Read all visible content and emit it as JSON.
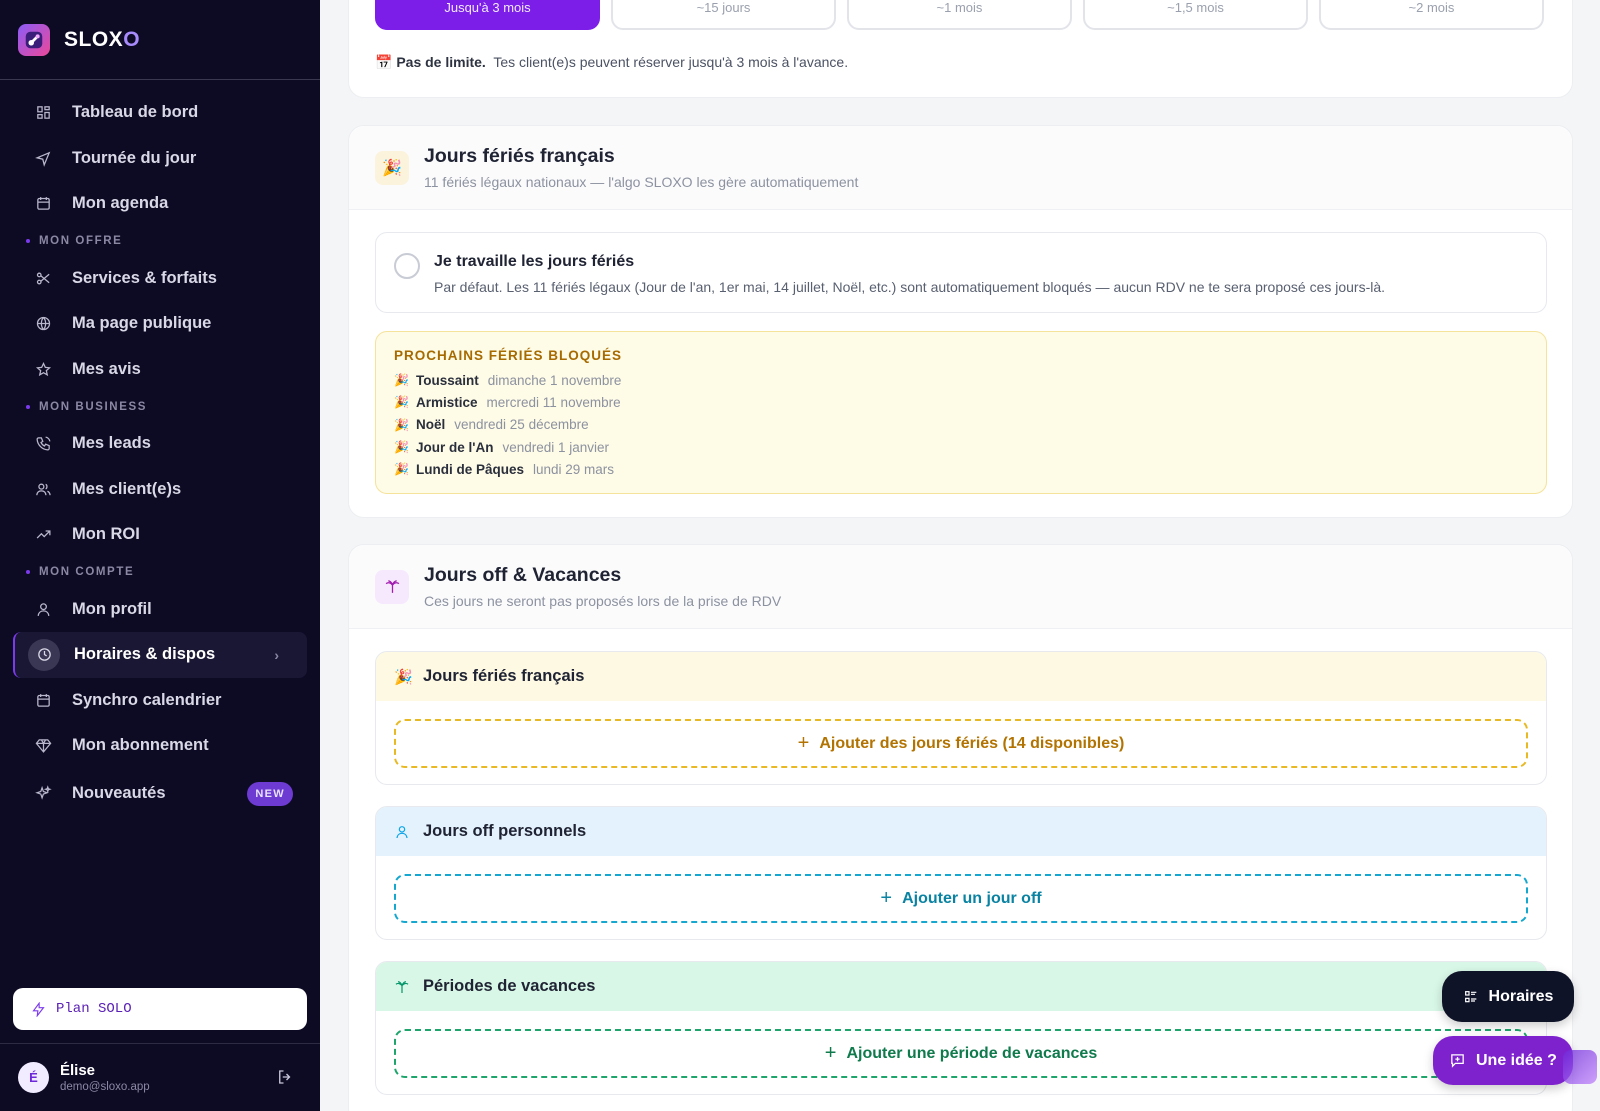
{
  "brand": {
    "name_main": "SLOX",
    "name_accent": "O"
  },
  "sidebar": {
    "top_items": [
      {
        "label": "Tableau de bord",
        "icon": "dashboard-icon"
      },
      {
        "label": "Tournée du jour",
        "icon": "navigation-icon"
      },
      {
        "label": "Mon agenda",
        "icon": "calendar-icon"
      }
    ],
    "sections": [
      {
        "title": "MON OFFRE",
        "items": [
          {
            "label": "Services & forfaits",
            "icon": "scissors-icon"
          },
          {
            "label": "Ma page publique",
            "icon": "globe-icon"
          },
          {
            "label": "Mes avis",
            "icon": "star-icon"
          }
        ]
      },
      {
        "title": "MON BUSINESS",
        "items": [
          {
            "label": "Mes leads",
            "icon": "phone-icon"
          },
          {
            "label": "Mes client(e)s",
            "icon": "users-icon"
          },
          {
            "label": "Mon ROI",
            "icon": "trending-up-icon"
          }
        ]
      },
      {
        "title": "MON COMPTE",
        "items": [
          {
            "label": "Mon profil",
            "icon": "user-icon"
          },
          {
            "label": "Horaires & dispos",
            "icon": "clock-icon",
            "active": true
          },
          {
            "label": "Synchro calendrier",
            "icon": "calendar-sync-icon"
          },
          {
            "label": "Mon abonnement",
            "icon": "diamond-icon"
          },
          {
            "label": "Nouveautés",
            "icon": "sparkles-icon",
            "badge": "NEW"
          }
        ]
      }
    ],
    "plan_label": "Plan SOLO",
    "user": {
      "initial": "É",
      "name": "Élise",
      "email": "demo@sloxo.app"
    }
  },
  "booking_range": {
    "options": [
      "Jusqu'à 3 mois",
      "~15 jours",
      "~1 mois",
      "~1,5 mois",
      "~2 mois"
    ],
    "selected": "Jusqu'à 3 mois",
    "note_icon": "📅",
    "note_bold": "Pas de limite.",
    "note_text": "Tes client(e)s peuvent réserver jusqu'à 3 mois à l'avance."
  },
  "holidays_card": {
    "icon": "🎉",
    "title": "Jours fériés français",
    "subtitle": "11 fériés légaux nationaux — l'algo SLOXO les gère automatiquement",
    "toggle_title": "Je travaille les jours fériés",
    "toggle_desc": "Par défaut. Les 11 fériés légaux (Jour de l'an, 1er mai, 14 juillet, Noël, etc.) sont automatiquement bloqués — aucun RDV ne te sera proposé ces jours-là.",
    "toggle_checked": false,
    "upcoming_title": "PROCHAINS FÉRIÉS BLOQUÉS",
    "upcoming": [
      {
        "name": "Toussaint",
        "date": "dimanche 1 novembre"
      },
      {
        "name": "Armistice",
        "date": "mercredi 11 novembre"
      },
      {
        "name": "Noël",
        "date": "vendredi 25 décembre"
      },
      {
        "name": "Jour de l'An",
        "date": "vendredi 1 janvier"
      },
      {
        "name": "Lundi de Pâques",
        "date": "lundi 29 mars"
      }
    ]
  },
  "off_card": {
    "icon": "palm-tree-icon",
    "title": "Jours off & Vacances",
    "subtitle": "Ces jours ne seront pas proposés lors de la prise de RDV",
    "blocks": [
      {
        "title": "Jours fériés français",
        "icon": "🎉",
        "button": "Ajouter des jours fériés (14 disponibles)"
      },
      {
        "title": "Jours off personnels",
        "icon": "user-icon",
        "button": "Ajouter un jour off"
      },
      {
        "title": "Périodes de vacances",
        "icon": "palm-tree-icon",
        "button": "Ajouter une période de vacances"
      }
    ]
  },
  "floating": {
    "hours_label": "Horaires",
    "idea_label": "Une idée ?"
  }
}
